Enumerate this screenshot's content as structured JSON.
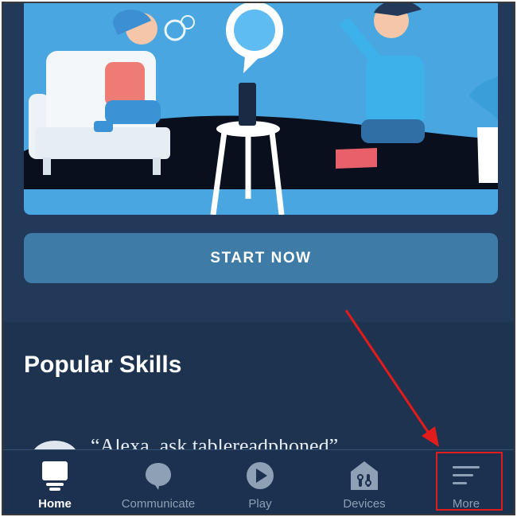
{
  "hero": {
    "start_button_label": "START NOW"
  },
  "popular": {
    "title": "Popular Skills",
    "first_skill_text": "“Alexa, ask tablereadphoned”"
  },
  "nav": {
    "items": [
      {
        "label": "Home",
        "icon": "home-icon",
        "active": true
      },
      {
        "label": "Communicate",
        "icon": "chat-bubble-icon",
        "active": false
      },
      {
        "label": "Play",
        "icon": "play-icon",
        "active": false
      },
      {
        "label": "Devices",
        "icon": "devices-icon",
        "active": false
      },
      {
        "label": "More",
        "icon": "menu-lines-icon",
        "active": false
      }
    ]
  },
  "colors": {
    "background": "#20354f",
    "hero": "#4aa6e0",
    "button": "#3e7ba6",
    "annotation": "#e21b1b"
  }
}
